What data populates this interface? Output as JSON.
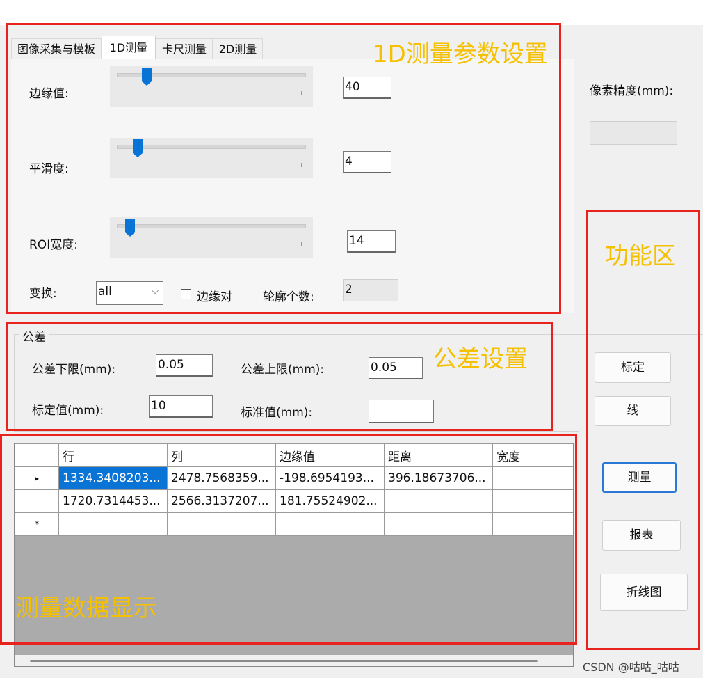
{
  "tabs": [
    "图像采集与模板",
    "1D测量",
    "卡尺测量",
    "2D测量"
  ],
  "params": {
    "edge_label": "边缘值:",
    "edge_value": "40",
    "smooth_label": "平滑度:",
    "smooth_value": "4",
    "roi_label": "ROI宽度:",
    "roi_value": "14",
    "transform_label": "变换:",
    "transform_value": "all",
    "edge_pair_label": "边缘对",
    "contour_count_label": "轮廓个数:",
    "contour_count_value": "2",
    "pixel_precision_label": "像素精度(mm):",
    "pixel_precision_value": ""
  },
  "sliders": {
    "edge": 0.16,
    "smooth": 0.11,
    "roi": 0.07
  },
  "tolerance": {
    "group_title": "公差",
    "lower_label": "公差下限(mm):",
    "lower_value": "0.05",
    "upper_label": "公差上限(mm):",
    "upper_value": "0.05",
    "calib_label": "标定值(mm):",
    "calib_value": "10",
    "standard_label": "标准值(mm):",
    "standard_value": ""
  },
  "buttons": {
    "calibrate": "标定",
    "line": "线",
    "measure": "测量",
    "report": "报表",
    "chart": "折线图"
  },
  "grid": {
    "columns": [
      "行",
      "列",
      "边缘值",
      "距离",
      "宽度"
    ],
    "rows": [
      [
        "1334.3408203...",
        "2478.7568359...",
        "-198.6954193...",
        "396.18673706...",
        ""
      ],
      [
        "1720.7314453...",
        "2566.3137207...",
        "181.75524902...",
        "",
        ""
      ],
      [
        "",
        "",
        "",
        "",
        ""
      ]
    ],
    "row_markers": [
      "▸",
      "",
      "*"
    ]
  },
  "annotations": {
    "params": "1D测量参数设置",
    "function": "功能区",
    "tolerance": "公差设置",
    "data": "测量数据显示"
  },
  "watermark": "CSDN @咕咕_咕咕",
  "colors": {
    "annotation_red": "#e8231d",
    "annotation_yellow": "#f5c000",
    "accent": "#0a74d6"
  }
}
